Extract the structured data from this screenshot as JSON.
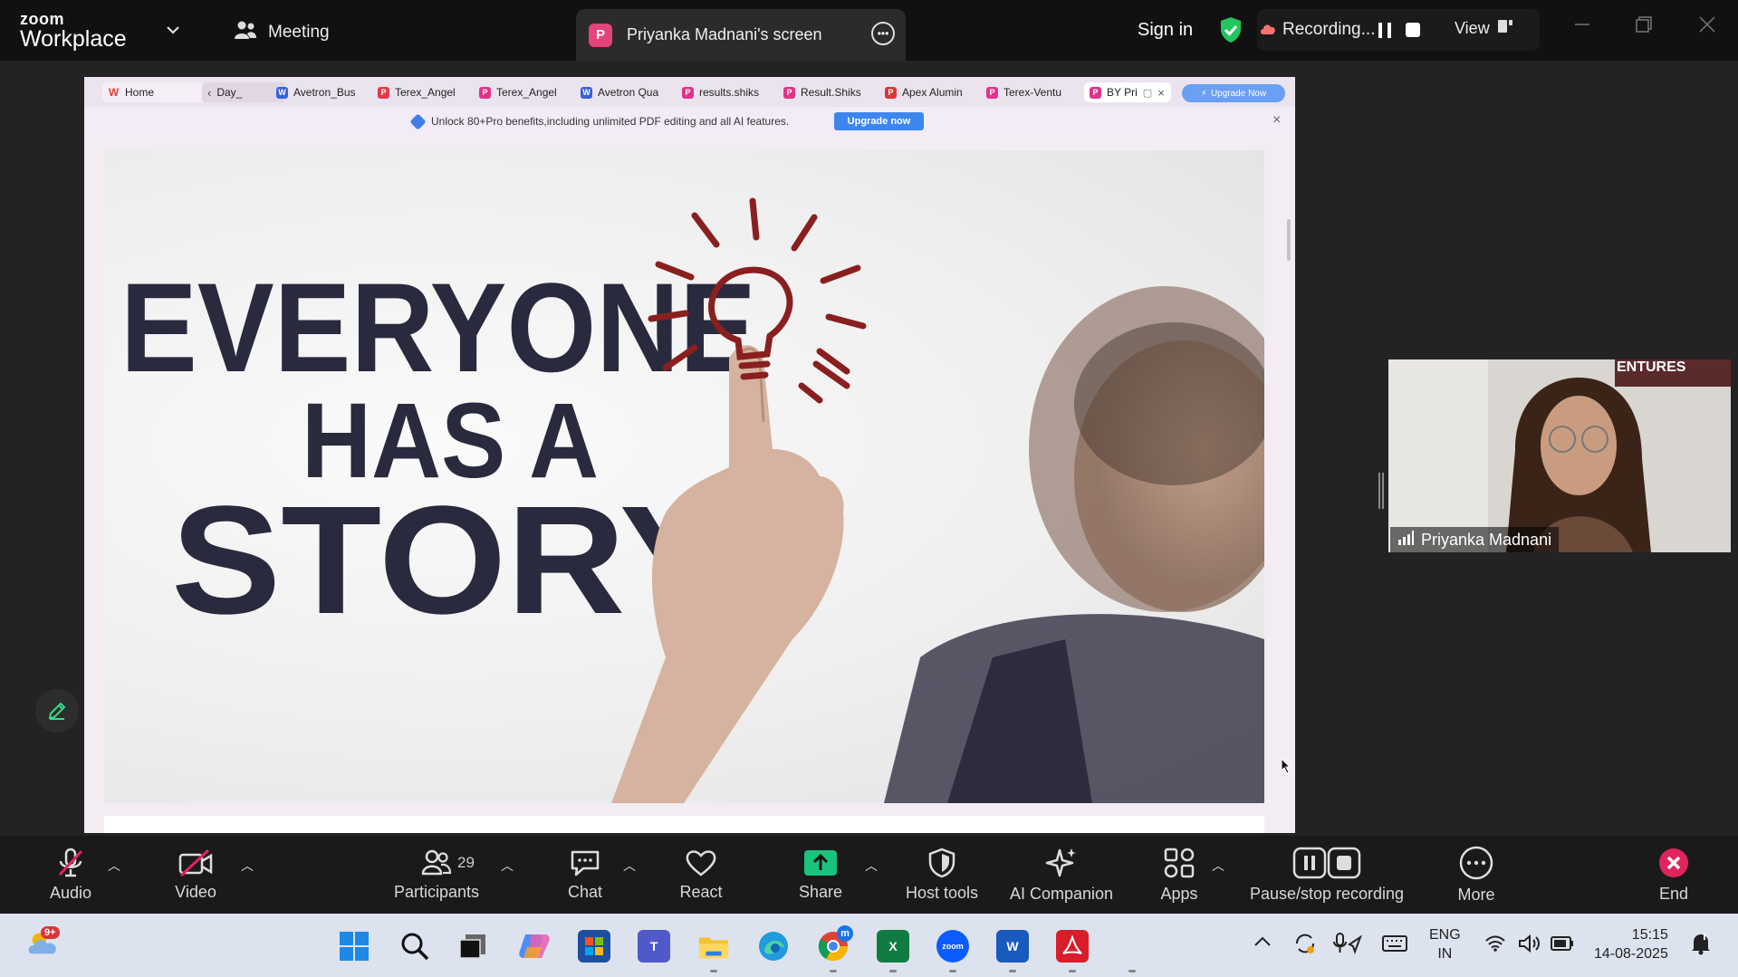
{
  "app": {
    "brand_top": "zoom",
    "brand_bottom": "Workplace"
  },
  "header": {
    "meeting_label": "Meeting",
    "screen_badge": "P",
    "screen_tab_label": "Priyanka Madnani's screen",
    "sign_in": "Sign in",
    "recording_label": "Recording...",
    "view_label": "View"
  },
  "browser": {
    "tabs": [
      {
        "label": "Home",
        "icon": "W",
        "color": "#e0403a"
      },
      {
        "label": "Day_",
        "icon": "",
        "color": "#9a9a9a"
      },
      {
        "label": "Avetron_Bus",
        "icon": "W",
        "color": "#3b5fd8"
      },
      {
        "label": "Terex_Angel",
        "icon": "P",
        "color": "#e03c4a"
      },
      {
        "label": "Terex_Angel",
        "icon": "P",
        "color": "#e0338a"
      },
      {
        "label": "Avetron Qua",
        "icon": "W",
        "color": "#3b5fd8"
      },
      {
        "label": "results.shiks",
        "icon": "P",
        "color": "#e0338a"
      },
      {
        "label": "Result.Shiks",
        "icon": "P",
        "color": "#e0338a"
      },
      {
        "label": "Apex Alumin",
        "icon": "P",
        "color": "#d93636"
      },
      {
        "label": "Terex-Ventu",
        "icon": "P",
        "color": "#e0338a"
      },
      {
        "label": "BY Pri",
        "icon": "P",
        "color": "#e0338a"
      }
    ],
    "upgrade_tab": "Upgrade Now",
    "promo_text": "Unlock 80+Pro benefits,including unlimited PDF editing and all AI features.",
    "promo_button": "Upgrade now"
  },
  "slide": {
    "line1": "EVERYONE",
    "line2": "HAS A",
    "line3": "STORY",
    "text_color": "#2a2a3e",
    "bulb_color": "#8a1f1f"
  },
  "video_tile": {
    "name": "Priyanka Madnani",
    "background_text": "ENTURES"
  },
  "toolbar": {
    "audio": "Audio",
    "video": "Video",
    "participants": "Participants",
    "participants_count": "29",
    "chat": "Chat",
    "react": "React",
    "share": "Share",
    "host_tools": "Host tools",
    "ai_companion": "AI Companion",
    "apps": "Apps",
    "pause_stop": "Pause/stop recording",
    "more": "More",
    "end": "End",
    "share_color": "#19c37d",
    "end_color": "#e0245e"
  },
  "taskbar": {
    "weather_badge": "9+",
    "lang_line1": "ENG",
    "lang_line2": "IN",
    "time": "15:15",
    "date": "14-08-2025"
  }
}
